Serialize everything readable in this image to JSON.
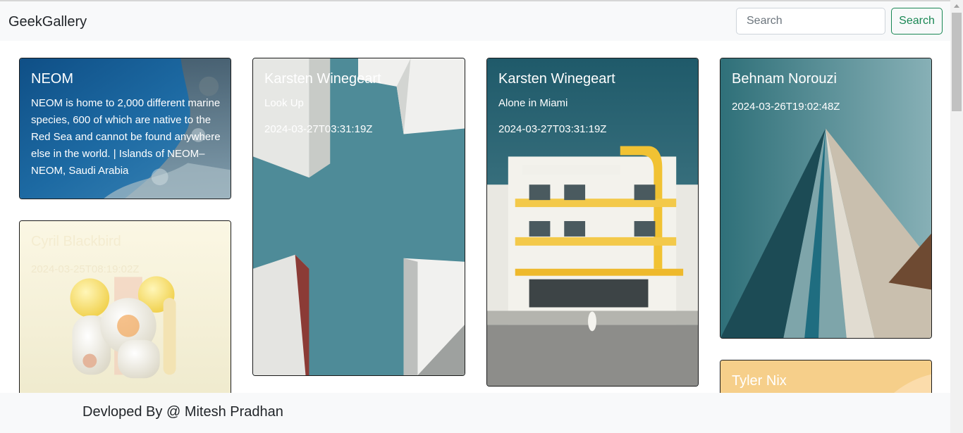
{
  "navbar": {
    "brand": "GeekGallery",
    "search_placeholder": "Search",
    "search_button": "Search"
  },
  "cards": [
    {
      "title": "NEOM",
      "description": "NEOM is home to 2,000 different marine species, 600 of which are native to the Red Sea and cannot be found anywhere else in the world. | Islands of NEOM– NEOM, Saudi Arabia"
    },
    {
      "title": "Karsten Winegeart",
      "description": "Look Up",
      "date": "2024-03-27T03:31:19Z"
    },
    {
      "title": "Karsten Winegeart",
      "description": "Alone in Miami",
      "date": "2024-03-27T03:31:19Z"
    },
    {
      "title": "Behnam Norouzi",
      "date": "2024-03-26T19:02:48Z"
    },
    {
      "title": "Cyril Blackbird",
      "date": "2024-03-25T08:19:02Z"
    },
    {
      "title": "Tyler Nix"
    }
  ],
  "footer": {
    "text": "Devloped By @ Mitesh Pradhan"
  }
}
